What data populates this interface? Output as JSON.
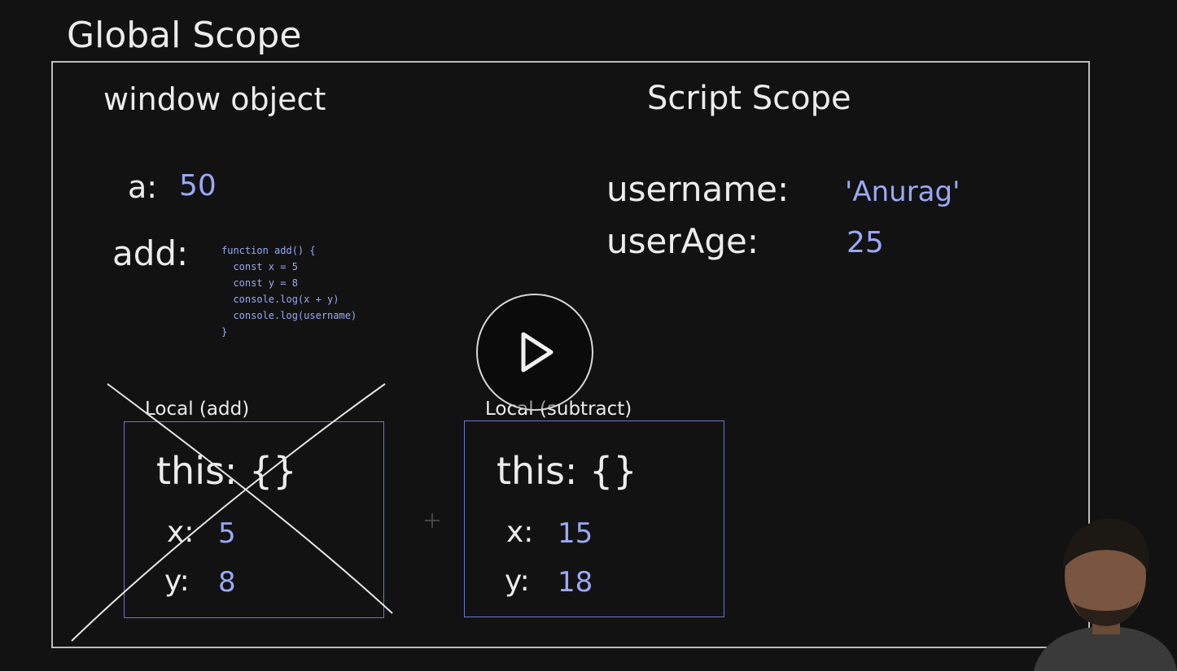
{
  "title": "Global Scope",
  "window_object": {
    "heading": "window object",
    "entries": [
      {
        "key": "a:",
        "value": "50"
      },
      {
        "key": "add:",
        "code": "function add() {\n  const x = 5\n  const y = 8\n  console.log(x + y)\n  console.log(username)\n}"
      }
    ]
  },
  "script_scope": {
    "heading": "Script Scope",
    "entries": [
      {
        "key": "username:",
        "value": "'Anurag'"
      },
      {
        "key": "userAge:",
        "value": "25"
      }
    ]
  },
  "local_add": {
    "label": "Local (add)",
    "this_label": "this: {}",
    "x_key": "x:",
    "x_value": "5",
    "y_key": "y:",
    "y_value": "8",
    "crossed_out": true
  },
  "local_subtract": {
    "label": "Local (subtract)",
    "this_label": "this: {}",
    "x_key": "x:",
    "x_value": "15",
    "y_key": "y:",
    "y_value": "18"
  },
  "video": {
    "play_icon": "play-icon"
  },
  "colors": {
    "background": "#121212",
    "text": "#ececec",
    "value": "#9aa8f7",
    "local_border": "#6a78c9"
  }
}
